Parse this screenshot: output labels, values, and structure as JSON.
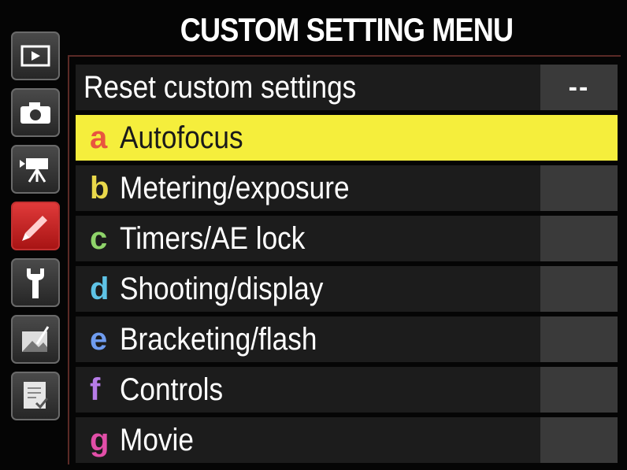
{
  "menu": {
    "title": "CUSTOM SETTING MENU"
  },
  "sidebar": {
    "items": [
      {
        "icon": "playback-icon",
        "active": false
      },
      {
        "icon": "camera-icon",
        "active": false
      },
      {
        "icon": "movie-camera-icon",
        "active": false
      },
      {
        "icon": "pencil-icon",
        "active": true
      },
      {
        "icon": "wrench-icon",
        "active": false
      },
      {
        "icon": "retouch-icon",
        "active": false
      },
      {
        "icon": "my-menu-icon",
        "active": false
      }
    ]
  },
  "reset": {
    "label": "Reset custom settings",
    "value": "--"
  },
  "items": [
    {
      "letter": "a",
      "label": "Autofocus",
      "color": "#e8553f"
    },
    {
      "letter": "b",
      "label": "Metering/exposure",
      "color": "#e9d84a"
    },
    {
      "letter": "c",
      "label": "Timers/AE lock",
      "color": "#8fd46a"
    },
    {
      "letter": "d",
      "label": "Shooting/display",
      "color": "#5ec3e6"
    },
    {
      "letter": "e",
      "label": "Bracketing/flash",
      "color": "#6f9cf0"
    },
    {
      "letter": "f",
      "label": "Controls",
      "color": "#b77ce8"
    },
    {
      "letter": "g",
      "label": "Movie",
      "color": "#e24ea8"
    }
  ],
  "colors": {
    "highlight": "#f5ee3c",
    "active_tab": "#c62828"
  }
}
